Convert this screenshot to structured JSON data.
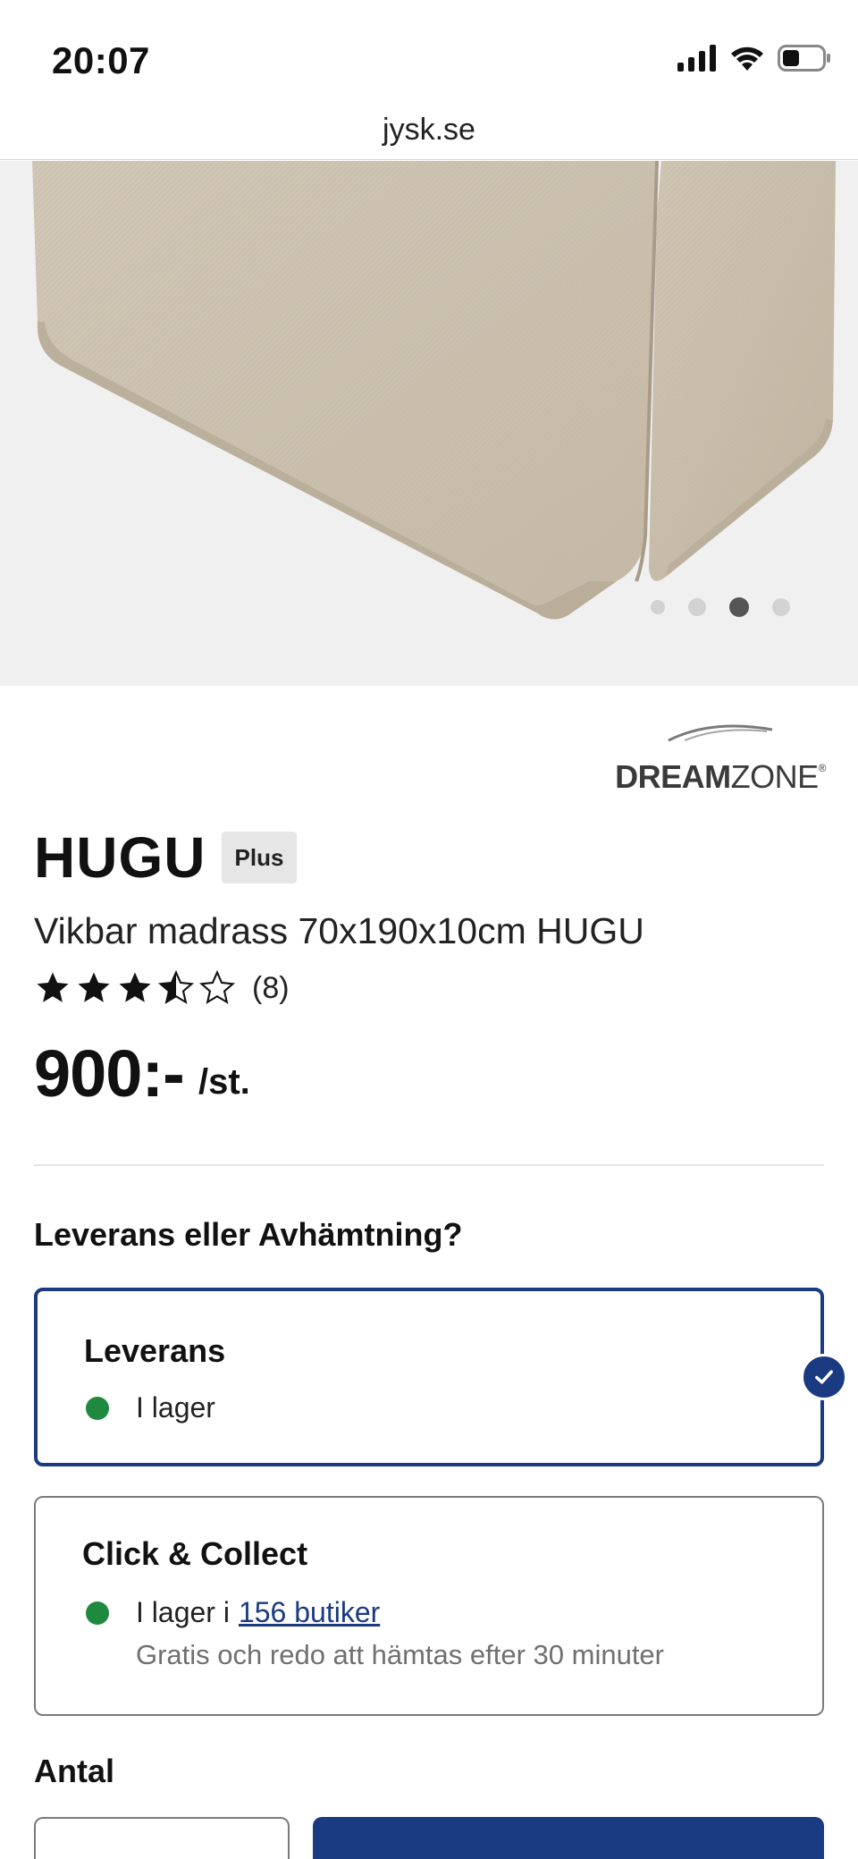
{
  "status_bar": {
    "time": "20:07",
    "icons": [
      "signal-icon",
      "wifi-icon",
      "battery-icon"
    ]
  },
  "browser": {
    "url": "jysk.se"
  },
  "carousel": {
    "total_slides": 4,
    "active_index": 2
  },
  "brand": {
    "name_bold": "DREAM",
    "name_regular": "ZONE",
    "registered": "®"
  },
  "product": {
    "name": "HUGU",
    "badge": "Plus",
    "description": "Vikbar madrass 70x190x10cm HUGU",
    "rating": 3.5,
    "rating_max": 5,
    "review_count": "(8)",
    "price": "900:-",
    "price_unit": "/st."
  },
  "fulfillment": {
    "heading": "Leverans eller Avhämtning?",
    "delivery": {
      "title": "Leverans",
      "stock": "I lager",
      "selected": true
    },
    "click_collect": {
      "title": "Click & Collect",
      "stock_prefix": "I lager i",
      "stores_link": "156 butiker",
      "subtext": "Gratis och redo att hämtas efter 30 minuter",
      "selected": false
    }
  },
  "quantity": {
    "heading": "Antal"
  },
  "colors": {
    "primary": "#1a3a82",
    "in_stock": "#1f8a3f",
    "muted_text": "#707070"
  }
}
